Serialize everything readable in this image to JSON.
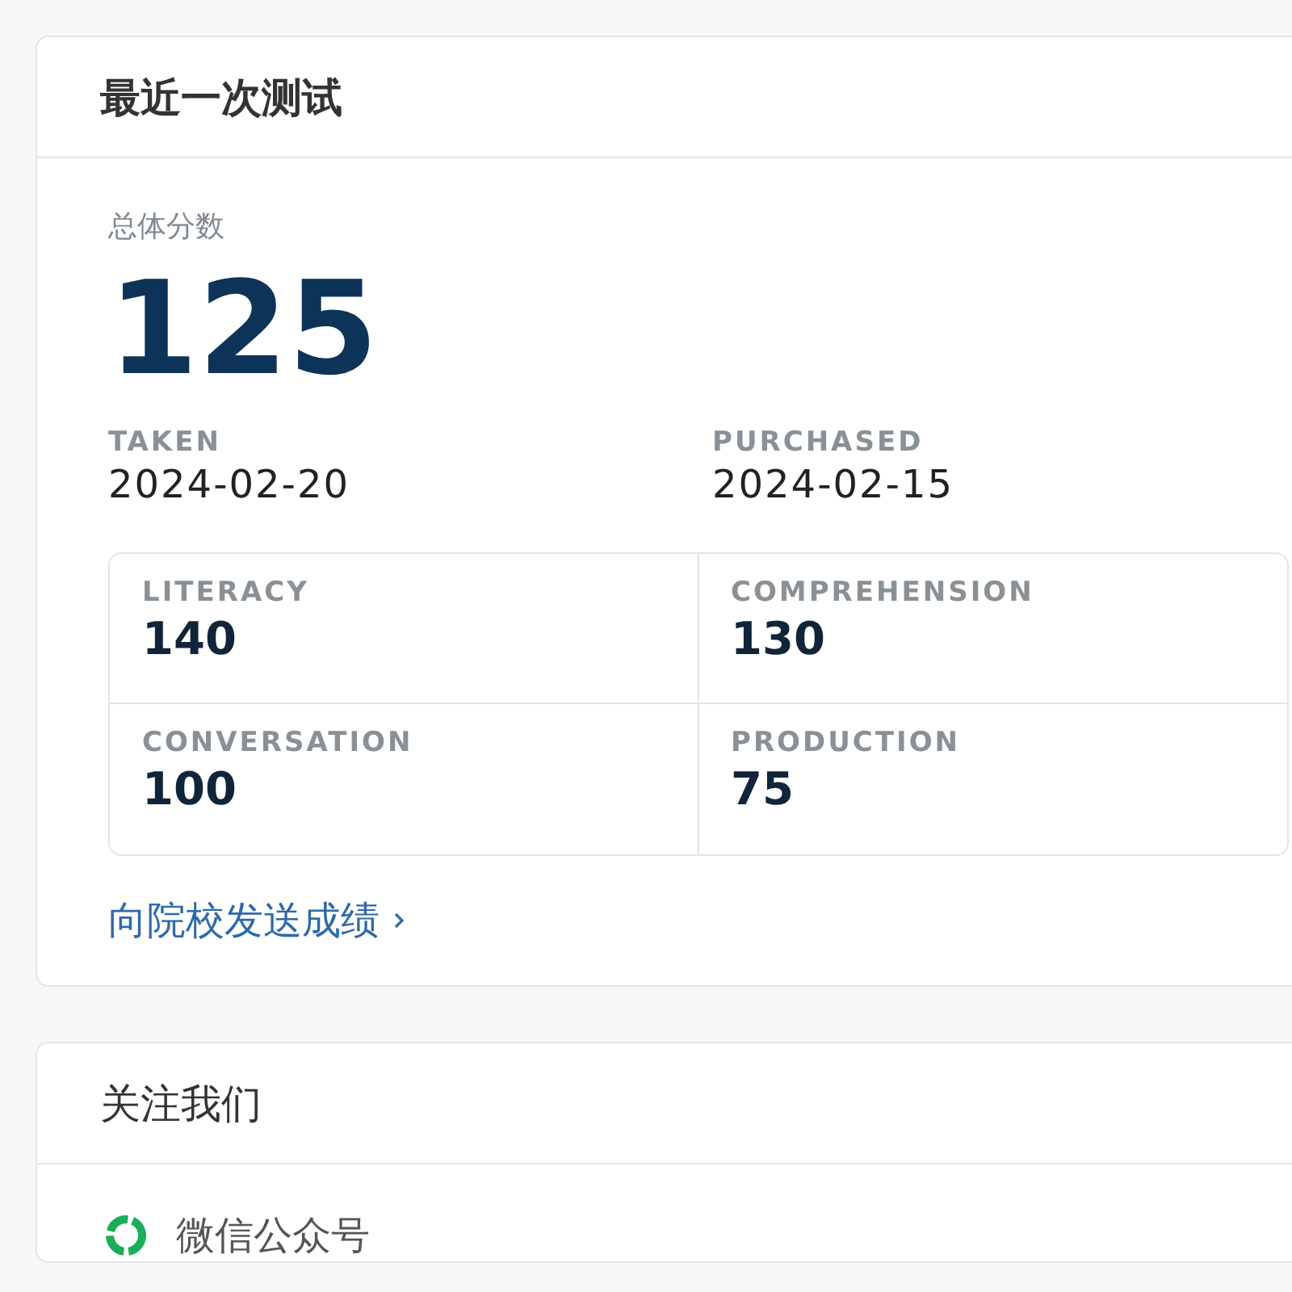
{
  "latest_test": {
    "title": "最近一次测试",
    "overall_label": "总体分数",
    "overall_score": "125",
    "dates": [
      {
        "label": "TAKEN",
        "value": "2024-02-20"
      },
      {
        "label": "PURCHASED",
        "value": "2024-02-15"
      }
    ],
    "subscores": [
      {
        "label": "LITERACY",
        "value": "140"
      },
      {
        "label": "COMPREHENSION",
        "value": "130"
      },
      {
        "label": "CONVERSATION",
        "value": "100"
      },
      {
        "label": "PRODUCTION",
        "value": "75"
      }
    ],
    "send_link": "向院校发送成绩"
  },
  "follow_us": {
    "title": "关注我们",
    "items": [
      {
        "label": "微信公众号"
      }
    ]
  }
}
